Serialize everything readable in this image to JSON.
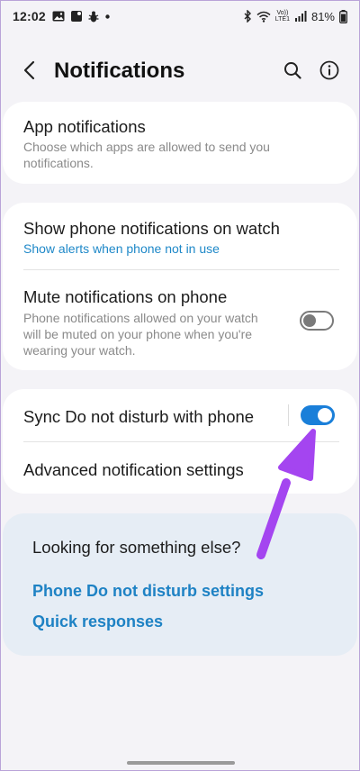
{
  "status_bar": {
    "time": "12:02",
    "battery": "81%",
    "icons_left": [
      "gallery-icon",
      "notification-dot-icon",
      "bug-icon",
      "dot-icon"
    ],
    "icons_right": [
      "bluetooth-icon",
      "wifi-icon",
      "volte-icon",
      "signal-icon",
      "battery-icon"
    ],
    "volte_label_top": "Vo))",
    "volte_label_bottom": "LTE1"
  },
  "app_bar": {
    "title": "Notifications",
    "back_icon": "chevron-left-icon",
    "search_icon": "search-icon",
    "info_icon": "info-icon"
  },
  "card1": {
    "title": "App notifications",
    "subtitle_line1": "Choose which apps are allowed to send you",
    "subtitle_line2": "notifications."
  },
  "card2": {
    "watch_title": "Show phone notifications on watch",
    "watch_sub": "Show alerts when phone not in use",
    "mute_title": "Mute notifications on phone",
    "mute_sub_line1": "Phone notifications allowed on your watch",
    "mute_sub_line2": "will be muted on your phone when you're",
    "mute_sub_line3": "wearing your watch.",
    "mute_toggle": "off"
  },
  "card3": {
    "sync_title": "Sync Do not disturb with phone",
    "sync_toggle": "on",
    "advanced_title": "Advanced notification settings"
  },
  "suggestions": {
    "title": "Looking for something else?",
    "links": [
      "Phone Do not disturb settings",
      "Quick responses"
    ]
  },
  "colors": {
    "background": "#f4f3f7",
    "card": "#ffffff",
    "accent_blue": "#1e82c4",
    "toggle_on": "#1a7fd9",
    "suggest_bg": "#e6edf5",
    "annotation_arrow": "#a445f0"
  }
}
